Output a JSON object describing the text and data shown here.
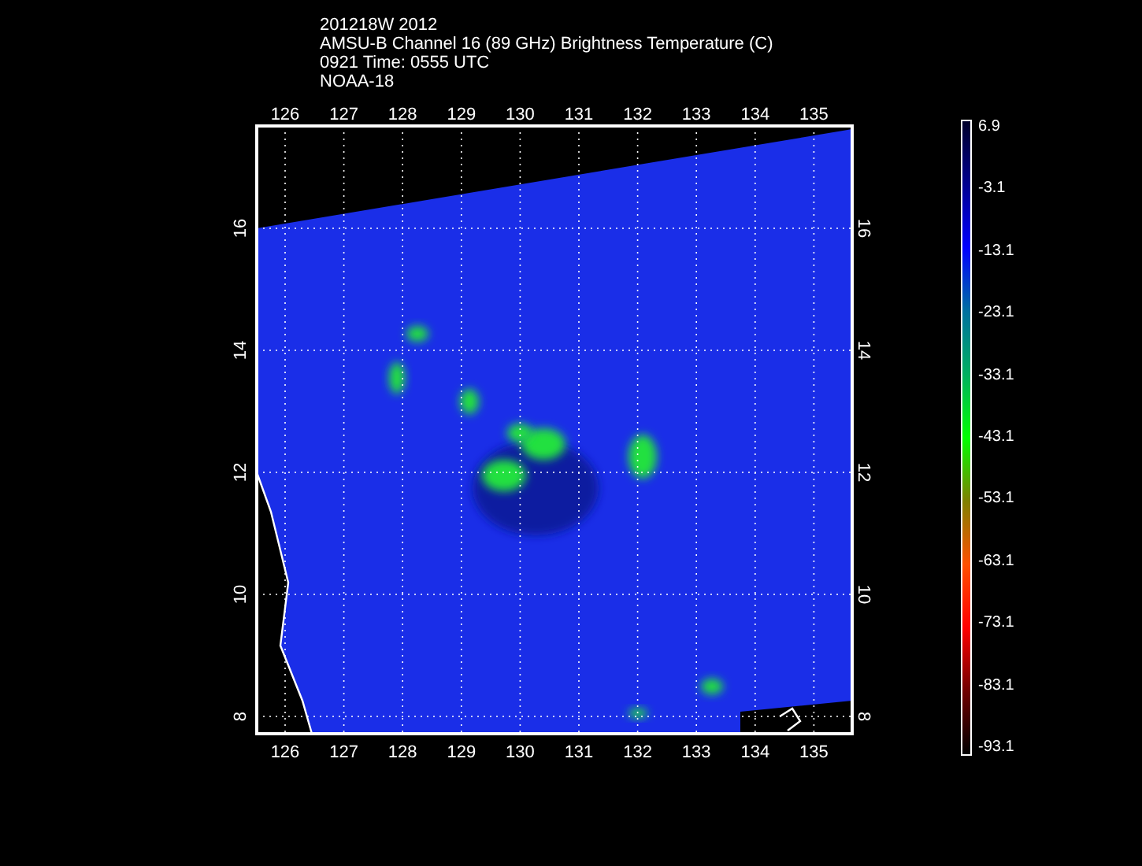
{
  "title_lines": [
    "201218W 2012",
    "AMSU-B Channel 16 (89 GHz) Brightness Temperature (C)",
    "0921 Time: 0555 UTC",
    "NOAA-18"
  ],
  "x_axis": {
    "top_labels": [
      "126",
      "127",
      "128",
      "129",
      "130",
      "131",
      "132",
      "133",
      "134",
      "135"
    ],
    "bottom_labels": [
      "126",
      "127",
      "128",
      "129",
      "130",
      "131",
      "132",
      "133",
      "134",
      "135"
    ]
  },
  "y_axis": {
    "left_labels": [
      "16",
      "14",
      "12",
      "10",
      "8"
    ],
    "right_labels": [
      "16",
      "14",
      "12",
      "10",
      "8"
    ]
  },
  "colorbar": {
    "labels": [
      "6.9",
      "-3.1",
      "-13.1",
      "-23.1",
      "-33.1",
      "-43.1",
      "-53.1",
      "-63.1",
      "-73.1",
      "-83.1",
      "-93.1"
    ]
  }
}
